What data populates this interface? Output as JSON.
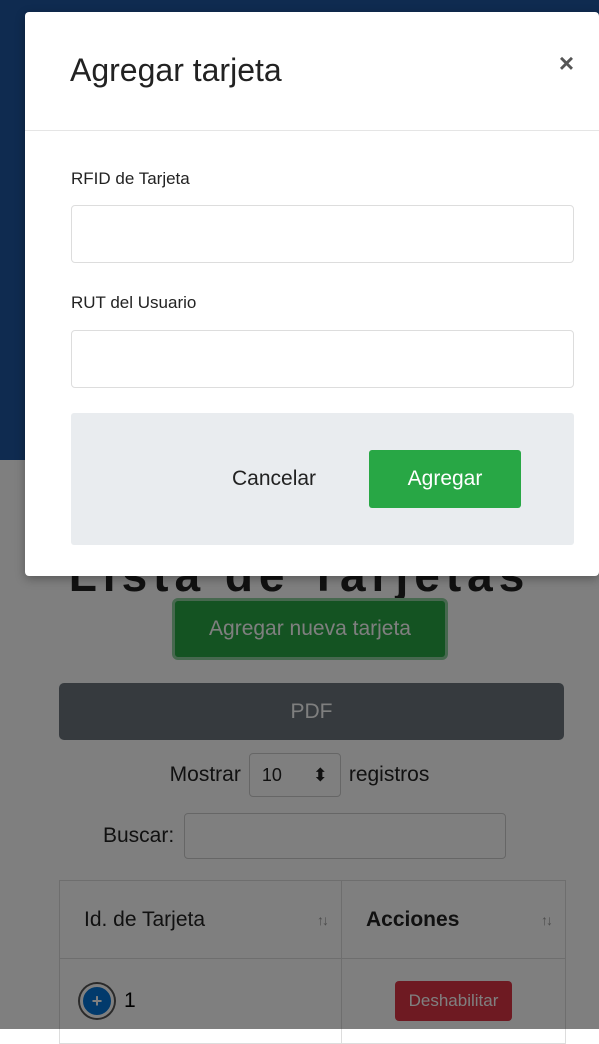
{
  "background": {
    "heading": "Lista de Tarjetas",
    "add_button": "Agregar nueva tarjeta",
    "pdf_button": "PDF",
    "length": {
      "prefix": "Mostrar",
      "value": "10",
      "suffix": "registros"
    },
    "search_label": "Buscar:",
    "table": {
      "headers": [
        "Id. de Tarjeta",
        "Acciones"
      ],
      "sort_icon": "↑↓",
      "rows": [
        {
          "id": "1",
          "expand_icon": "+",
          "action": "Deshabilitar"
        }
      ]
    }
  },
  "modal": {
    "title": "Agregar tarjeta",
    "close": "×",
    "fields": [
      {
        "label": "RFID de Tarjeta",
        "value": "",
        "placeholder": ""
      },
      {
        "label": "RUT del Usuario",
        "value": "",
        "placeholder": ""
      }
    ],
    "cancel_label": "Cancelar",
    "submit_label": "Agregar"
  },
  "colors": {
    "primary_blue": "#1e56a0",
    "success_green": "#28a745",
    "danger_red": "#dc3545",
    "secondary_gray": "#6c757d"
  }
}
